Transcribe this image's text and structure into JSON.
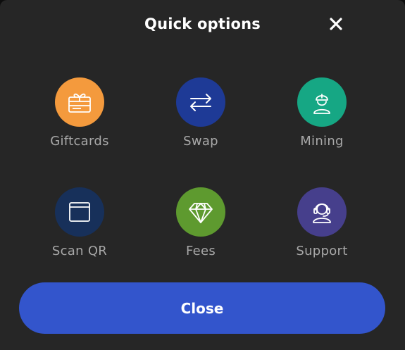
{
  "header": {
    "title": "Quick options",
    "close_icon": "close-icon"
  },
  "options": [
    {
      "label": "Giftcards",
      "icon": "gift-card-icon",
      "color": "#F49A3D"
    },
    {
      "label": "Swap",
      "icon": "swap-arrows-icon",
      "color": "#1E3A96"
    },
    {
      "label": "Mining",
      "icon": "miner-helmet-icon",
      "color": "#16A784"
    },
    {
      "label": "Scan QR",
      "icon": "scan-window-icon",
      "color": "#17305A"
    },
    {
      "label": "Fees",
      "icon": "diamond-icon",
      "color": "#5E9A2F"
    },
    {
      "label": "Support",
      "icon": "headset-agent-icon",
      "color": "#463F8C"
    }
  ],
  "footer": {
    "close_label": "Close",
    "close_color": "#3355CC"
  }
}
